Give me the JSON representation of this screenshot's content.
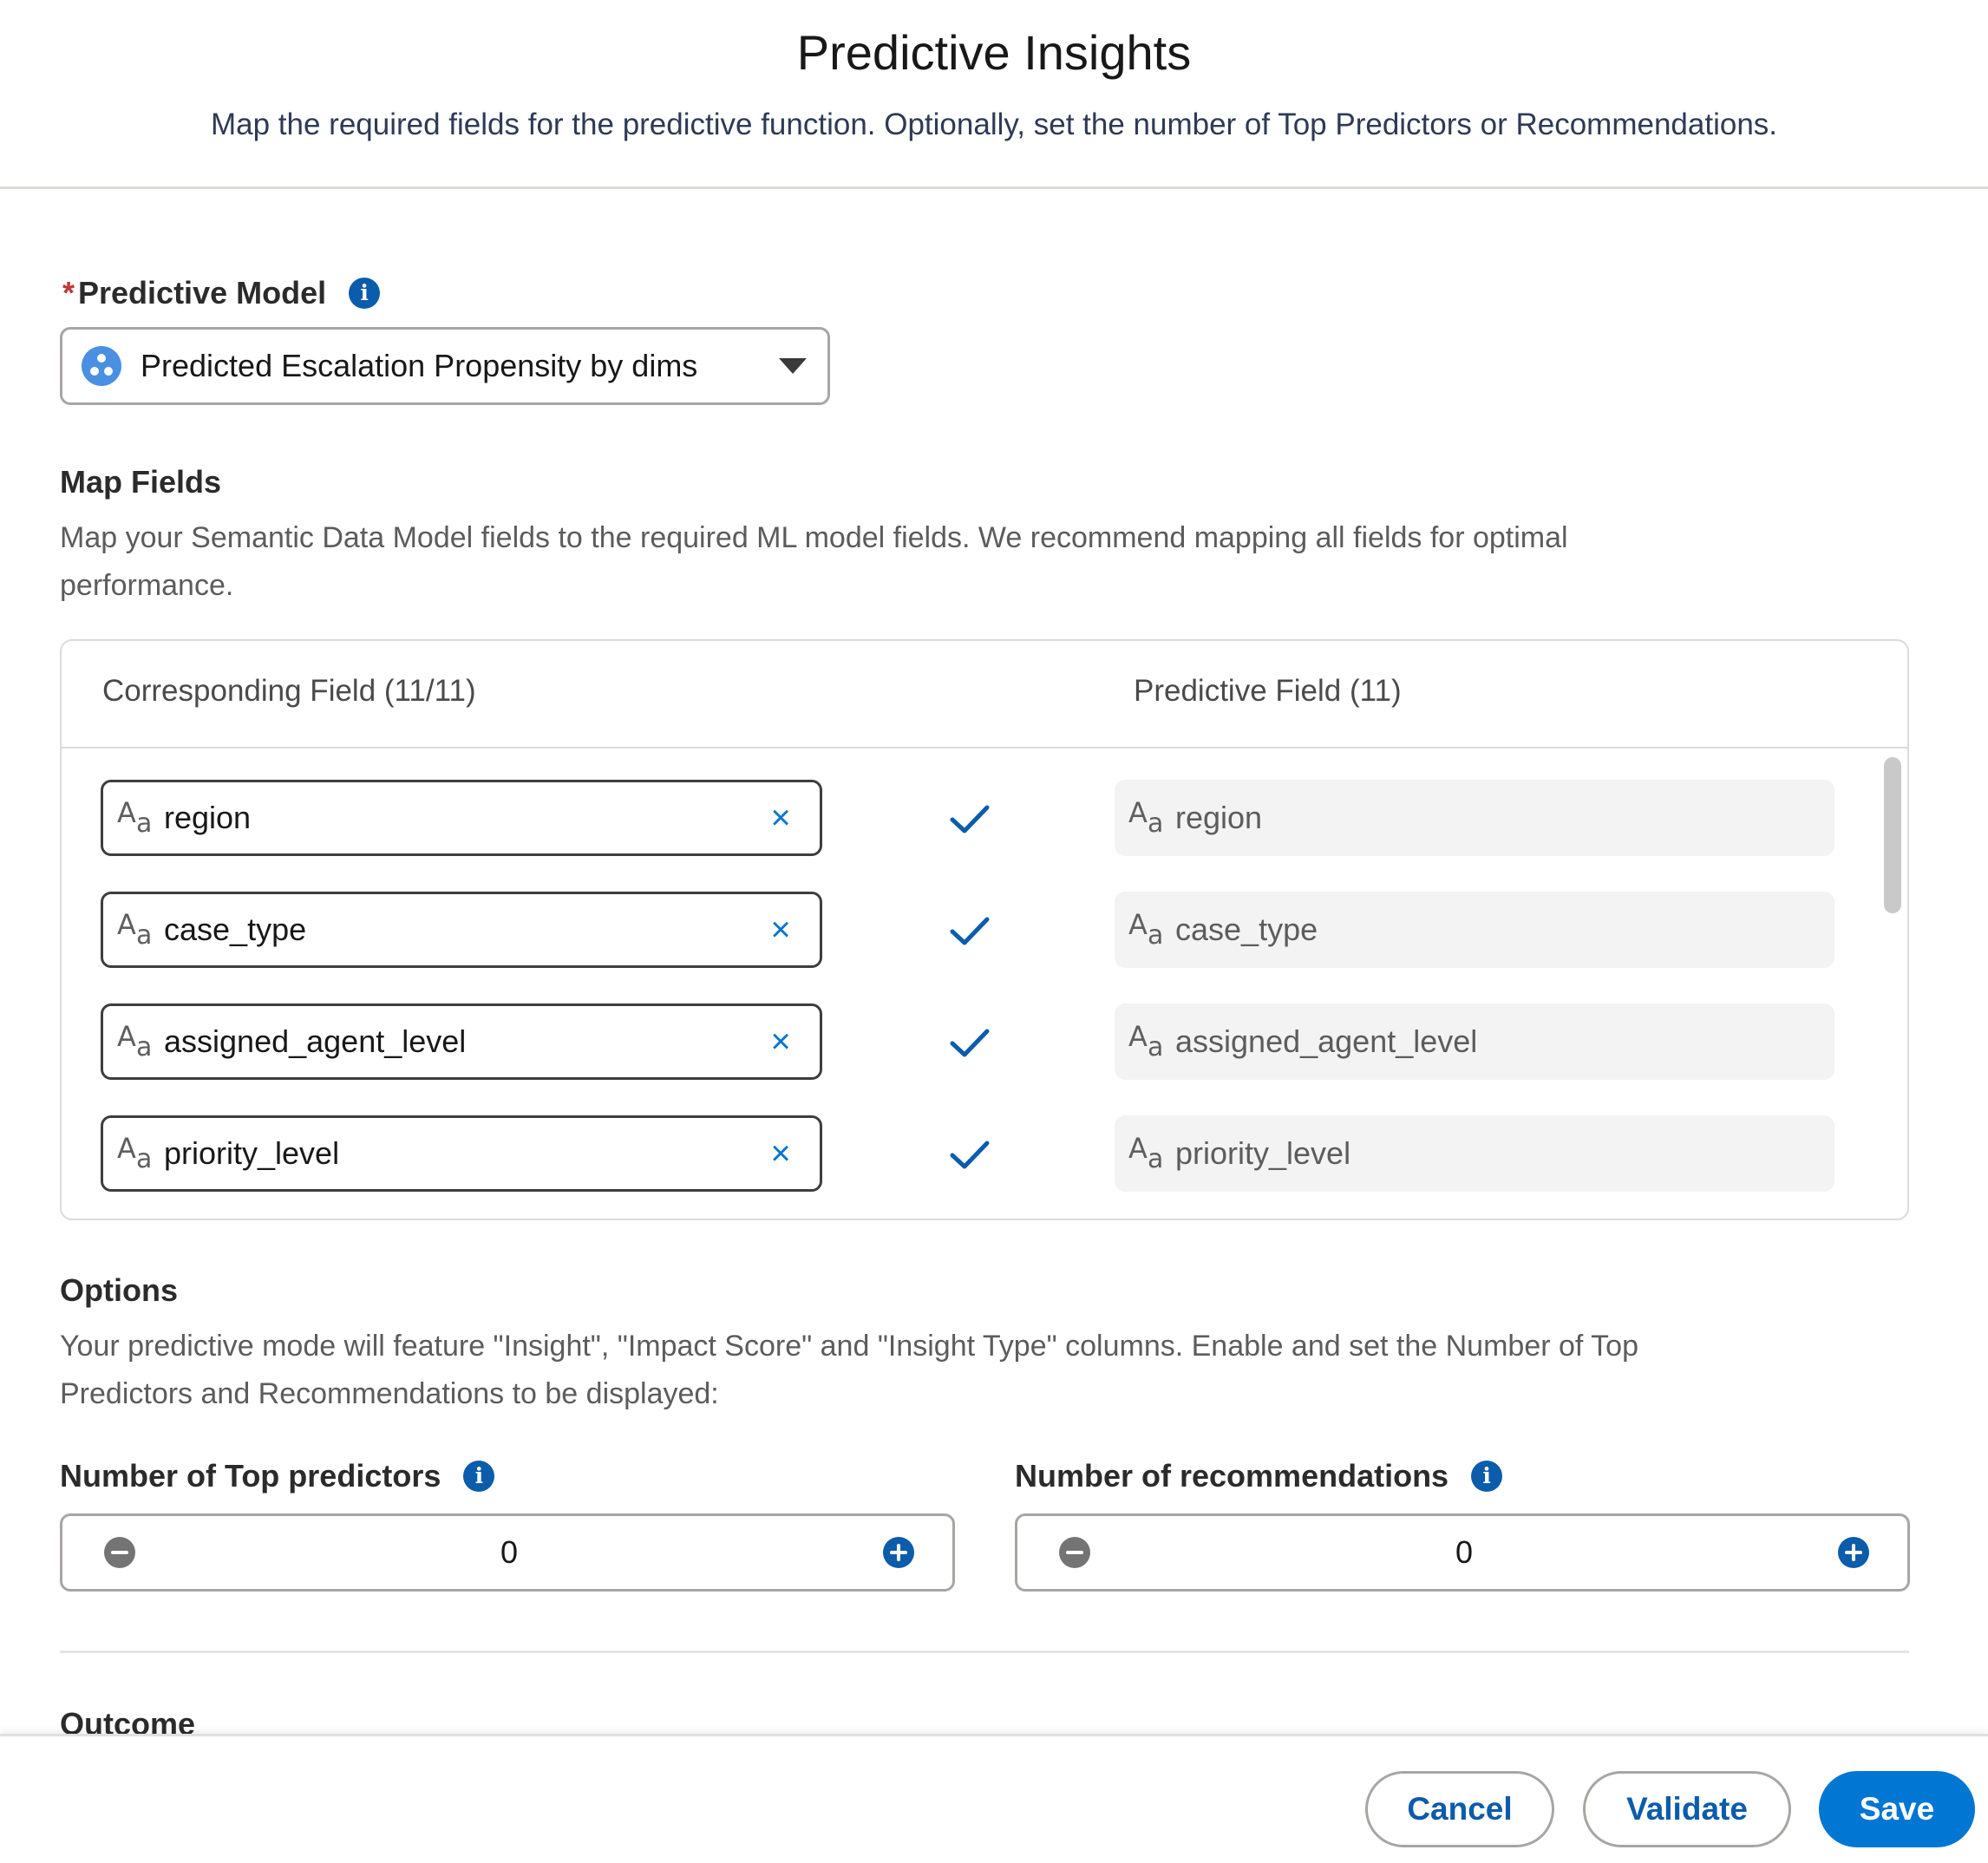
{
  "header": {
    "title": "Predictive Insights",
    "subtitle": "Map the required fields for the predictive function. Optionally, set the number of Top Predictors or Recommendations."
  },
  "model": {
    "required_marker": "*",
    "label": "Predictive Model",
    "selected": "Predicted Escalation Propensity by dims"
  },
  "map_fields": {
    "title": "Map Fields",
    "description_line1": "Map your Semantic Data Model fields to the required ML model fields. We recommend mapping all fields for optimal",
    "description_line2": "performance.",
    "col_corresponding": "Corresponding Field (11/11)",
    "col_predictive": "Predictive Field (11)",
    "field_type_icon": "text-type-icon",
    "type_glyph_upper": "A",
    "type_glyph_lower": "a",
    "clear_glyph": "×",
    "rows": [
      {
        "corresponding": "region",
        "predictive": "region"
      },
      {
        "corresponding": "case_type",
        "predictive": "case_type"
      },
      {
        "corresponding": "assigned_agent_level",
        "predictive": "assigned_agent_level"
      },
      {
        "corresponding": "priority_level",
        "predictive": "priority_level"
      }
    ]
  },
  "options": {
    "title": "Options",
    "description_line1": "Your predictive mode will feature \"Insight\", \"Impact Score\" and \"Insight Type\" columns. Enable and set the Number of Top",
    "description_line2": "Predictors and Recommendations to be displayed:",
    "top_predictors": {
      "label": "Number of Top predictors",
      "value": "0"
    },
    "recommendations": {
      "label": "Number of recommendations",
      "value": "0"
    }
  },
  "outcome": {
    "title": "Outcome"
  },
  "footer": {
    "cancel": "Cancel",
    "validate": "Validate",
    "save": "Save"
  },
  "colors": {
    "brand": "#0176d3",
    "info_icon": "#0b5cab",
    "required": "#c23934"
  }
}
